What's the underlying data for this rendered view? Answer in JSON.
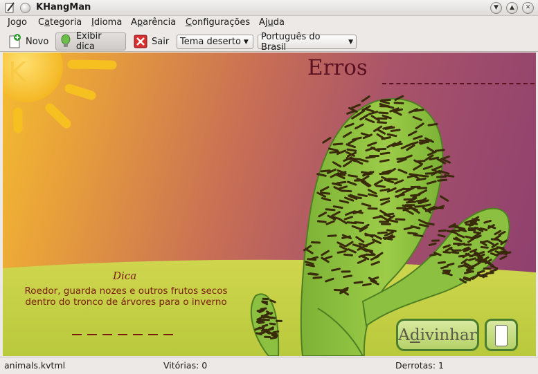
{
  "window": {
    "title": "KHangMan",
    "icon": "pencil-notepad-icon",
    "controls": [
      "minimize",
      "maximize",
      "close"
    ]
  },
  "menu": {
    "items": [
      {
        "label": "Jogo",
        "accel": "J",
        "rest": "ogo"
      },
      {
        "label": "Categoria",
        "accel": "a",
        "pre": "C",
        "rest": "tegoria"
      },
      {
        "label": "Idioma",
        "accel": "I",
        "rest": "dioma"
      },
      {
        "label": "Aparência",
        "accel": "p",
        "pre": "A",
        "rest": "arência"
      },
      {
        "label": "Configurações",
        "accel": "C",
        "rest": "onfigurações"
      },
      {
        "label": "Ajuda",
        "accel": "u",
        "pre": "Aj",
        "rest": "da"
      }
    ]
  },
  "toolbar": {
    "new_label": "Novo",
    "hint_label": "Exibir dica",
    "quit_label": "Sair",
    "theme_value": "Tema deserto",
    "language_value": "Português do Brasil"
  },
  "game": {
    "errors_label": "Erros",
    "hint_title": "Dica",
    "hint_text": "Roedor, guarda nozes e outros frutos secos dentro do tronco de árvores para o inverno",
    "word_slot_count": 7,
    "guess_button_pre": "A",
    "guess_button_accel": "d",
    "guess_button_rest": "ivinhar",
    "guess_button_label": "Adivinhar",
    "letter_input_value": ""
  },
  "status": {
    "file": "animals.kvtml",
    "wins": "Vitórias: 0",
    "losses": "Derrotas: 1"
  },
  "colors": {
    "sky_left": "#f4bd30",
    "sky_right": "#8c3e6e",
    "sun": "#f6c22a",
    "cactus": "#8cbf3c",
    "ground": "#c8d24a",
    "text_dark_red": "#7a1a10",
    "button_border": "#4d7d2f"
  }
}
